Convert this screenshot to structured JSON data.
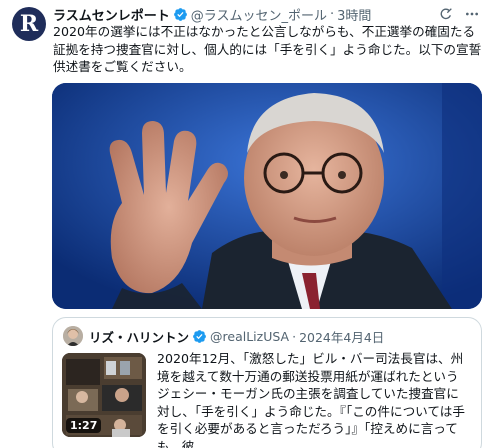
{
  "post": {
    "avatar_letter": "R",
    "author_name": "ラスムセンレポート",
    "handle": "@ラスムッセン_ポール",
    "dot": "·",
    "time": "3時間",
    "text": "2020年の選挙には不正はなかったと公言しながらも、不正選挙の確固たる証拠を持つ捜査官に対し、個人的には「手を引く」よう命じた。以下の宣誓供述書をご覧ください。",
    "icons": {
      "verified": "verified-badge-icon",
      "grok": "grok-icon",
      "more": "more-icon"
    }
  },
  "quote": {
    "author_name": "リズ・ハリントン",
    "handle": "@realLizUSA",
    "dot": "·",
    "date": "2024年4月4日",
    "video_duration": "1:27",
    "text": "2020年12月、「激怒した」ビル・バー司法長官は、州境を越えて数十万通の郵送投票用紙が運ばれたというジェシー・モーガン氏の主張を調査していた捜査官に対し、「手を引く」よう命じた。『「この件については手を引く必要があると言っただろう」』「控えめに言っても、彼..."
  },
  "colors": {
    "text": "#0f1419",
    "muted": "#536471",
    "verified": "#1d9bf0",
    "border": "#cfd9de",
    "photo_bg": "#1a4fb8"
  }
}
